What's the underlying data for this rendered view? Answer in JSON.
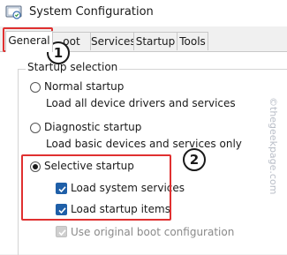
{
  "window": {
    "title": "System Configuration",
    "icon": "system-config-icon"
  },
  "tabs": [
    {
      "label": "General",
      "active": true
    },
    {
      "label": "oot",
      "active": false
    },
    {
      "label": "Services",
      "active": false
    },
    {
      "label": "Startup",
      "active": false
    },
    {
      "label": "Tools",
      "active": false
    }
  ],
  "startup": {
    "group_label": "Startup selection",
    "normal": {
      "label": "Normal startup",
      "desc": "Load all device drivers and services",
      "selected": false
    },
    "diagnostic": {
      "label": "Diagnostic startup",
      "desc": "Load basic devices and services only",
      "selected": false
    },
    "selective": {
      "label": "Selective startup",
      "selected": true,
      "options": [
        {
          "label": "Load system services",
          "checked": true,
          "enabled": true
        },
        {
          "label": "Load startup items",
          "checked": true,
          "enabled": true
        },
        {
          "label": "Use original boot configuration",
          "checked": true,
          "enabled": false
        }
      ]
    }
  },
  "annotations": {
    "step1": "1",
    "step2": "2",
    "highlight_color": "#e03030"
  },
  "watermark": "©thegeekpage.com",
  "colors": {
    "accent": "#1f5fa8"
  }
}
